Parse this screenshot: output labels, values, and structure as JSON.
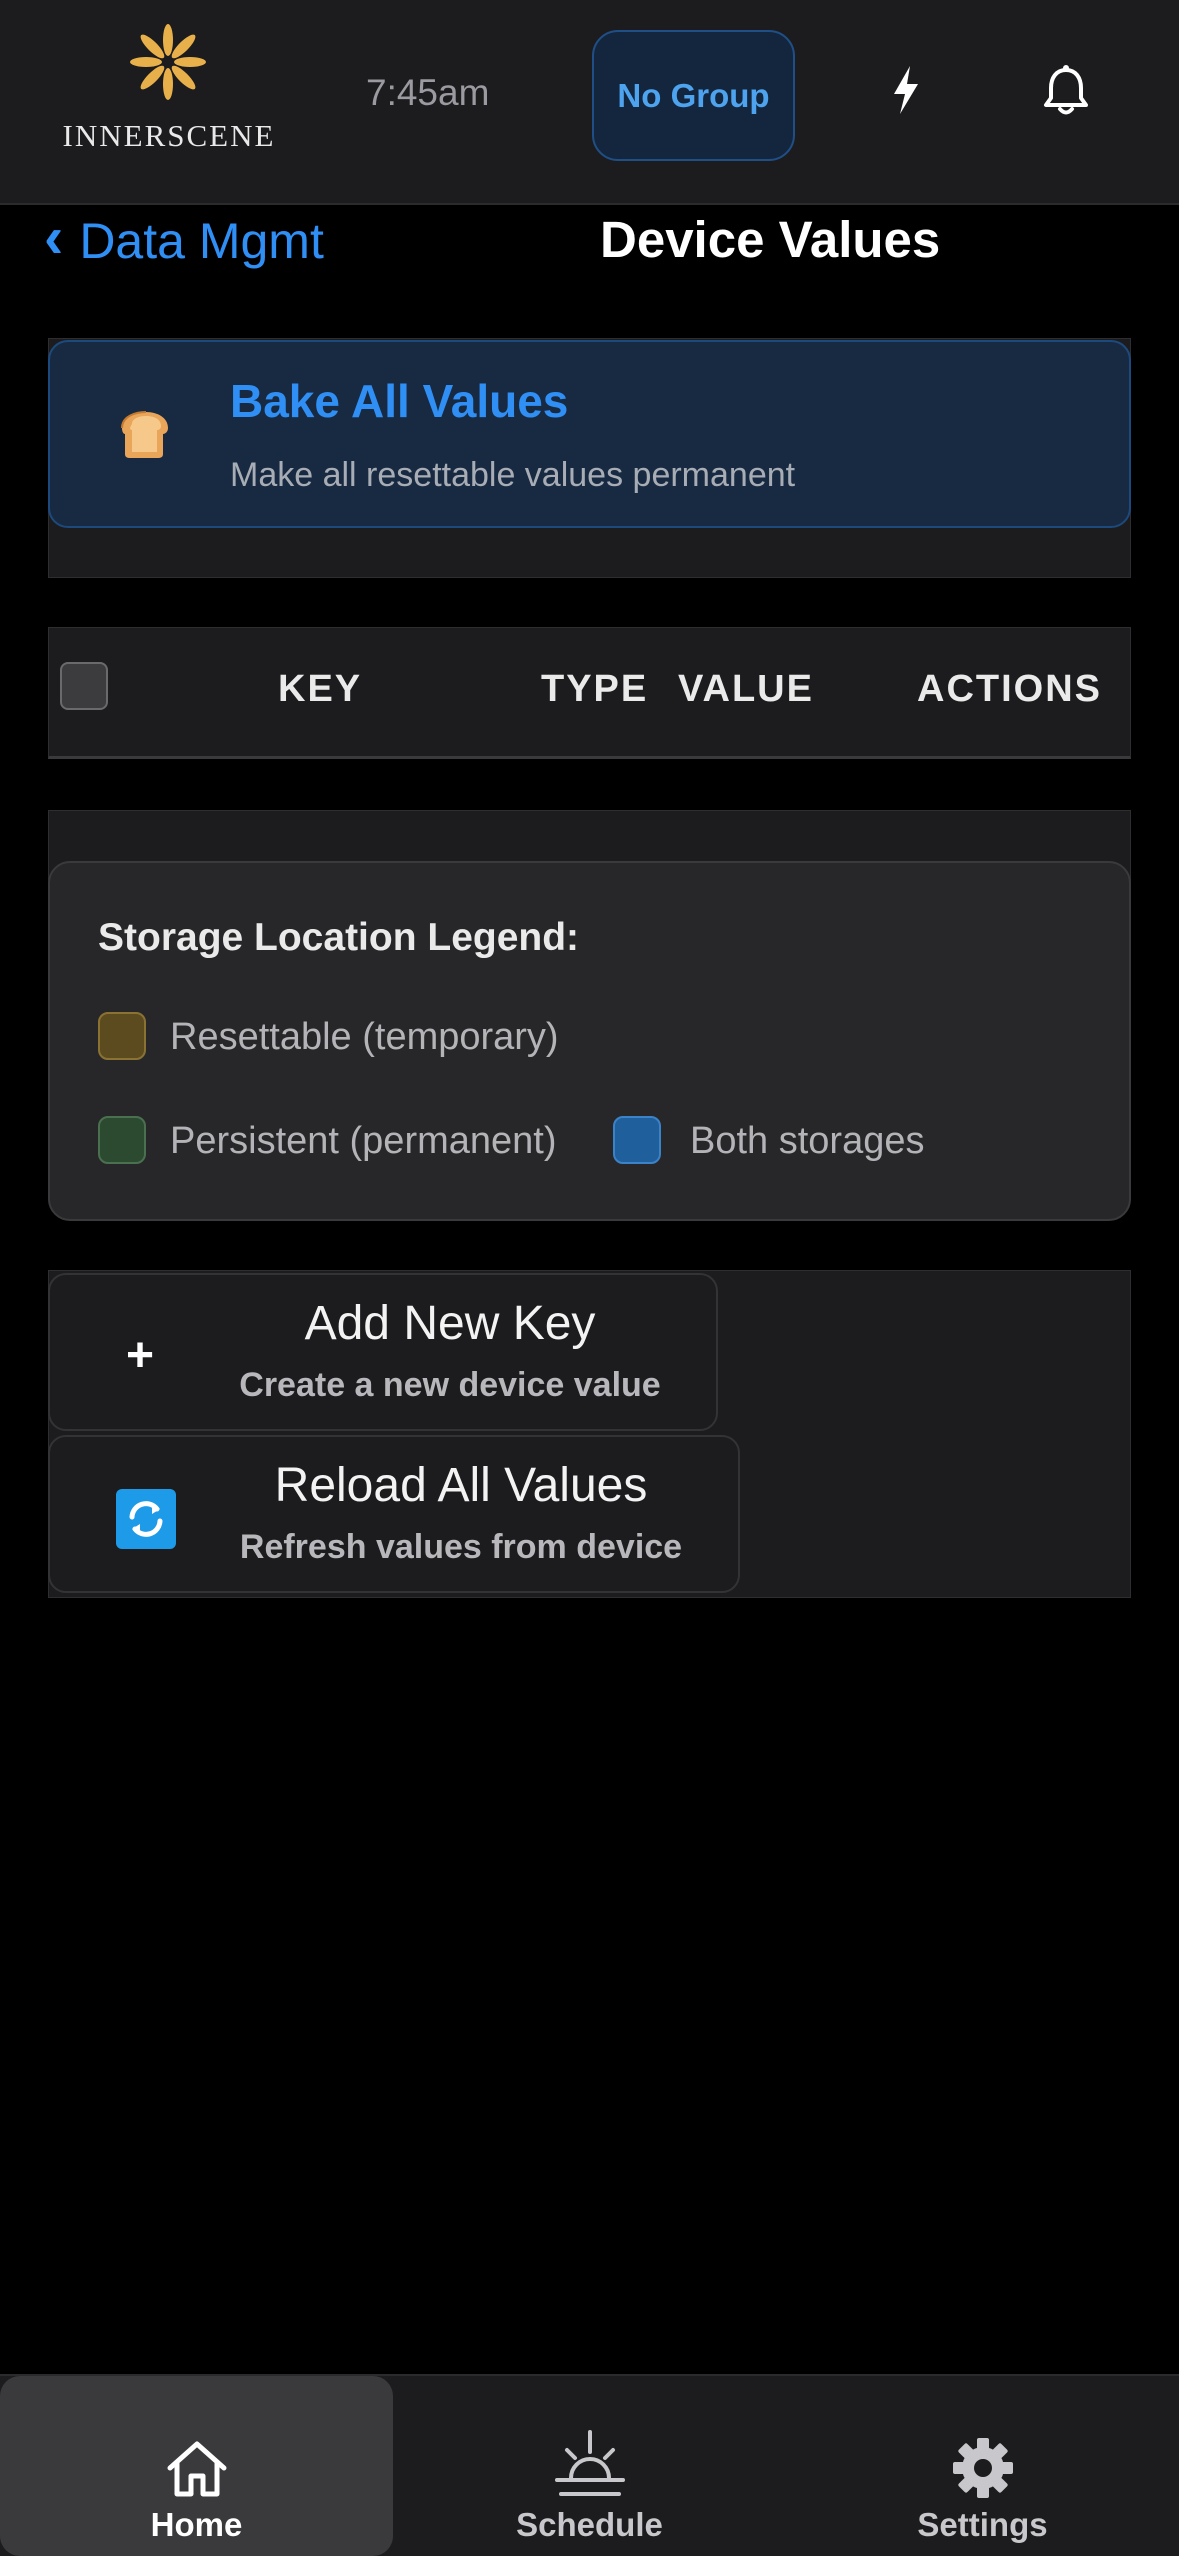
{
  "header": {
    "brand": "INNERSCENE",
    "time": "7:45am",
    "group_label": "No Group",
    "icons": [
      "logo-flower-icon",
      "bolt-icon",
      "bell-icon"
    ]
  },
  "subnav": {
    "back_chevron": "‹",
    "back_label": "Data Mgmt",
    "title": "Device Values"
  },
  "bake": {
    "icon": "bread-icon",
    "title": "Bake All Values",
    "subtitle": "Make all resettable values permanent"
  },
  "table": {
    "columns": [
      "KEY",
      "TYPE",
      "VALUE",
      "ACTIONS"
    ]
  },
  "legend": {
    "title": "Storage Location Legend:",
    "items": [
      {
        "label": "Resettable (temporary)",
        "color": "#5c4b1f"
      },
      {
        "label": "Persistent (permanent)",
        "color": "#2c4a30"
      },
      {
        "label": "Both storages",
        "color": "#1f5f9c"
      }
    ]
  },
  "actions": {
    "add": {
      "icon": "plus-icon",
      "glyph": "+",
      "title": "Add New Key",
      "subtitle": "Create a new device value"
    },
    "reload": {
      "icon": "refresh-icon",
      "title": "Reload All Values",
      "subtitle": "Refresh values from device"
    }
  },
  "bottom_nav": {
    "items": [
      {
        "label": "Home",
        "icon": "home-icon",
        "active": true
      },
      {
        "label": "Schedule",
        "icon": "sunrise-icon",
        "active": false
      },
      {
        "label": "Settings",
        "icon": "gear-icon",
        "active": false
      }
    ]
  },
  "colors": {
    "accent": "#2f8ff5",
    "background": "#000000",
    "surface": "#1c1c1e"
  }
}
